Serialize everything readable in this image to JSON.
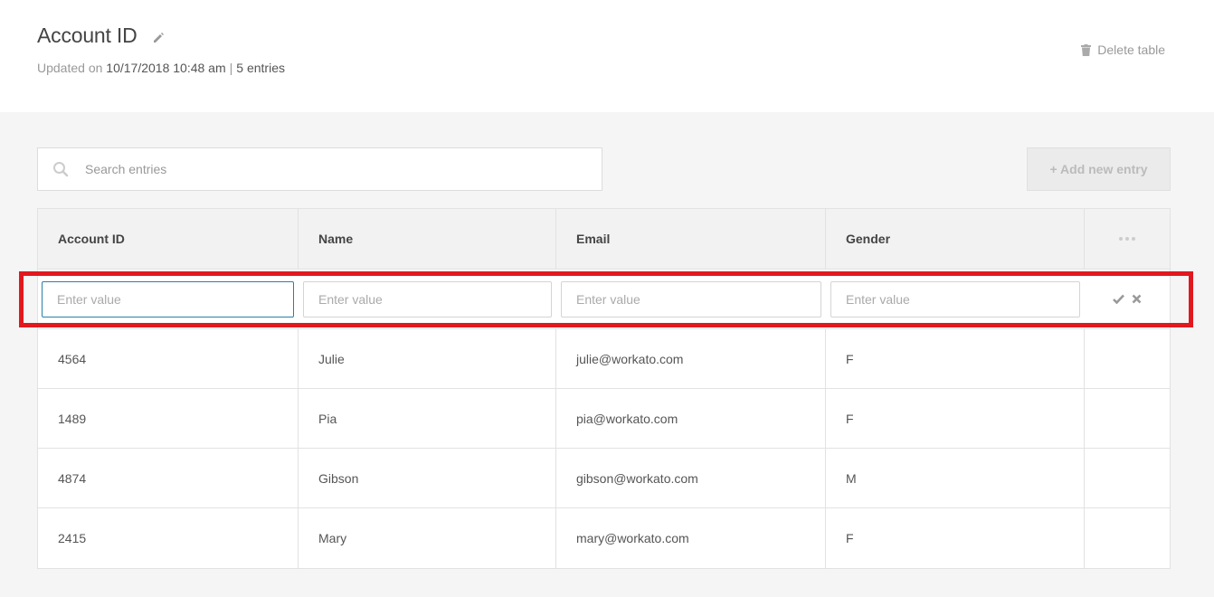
{
  "header": {
    "title": "Account ID",
    "updated_prefix": "Updated on",
    "updated_value": "10/17/2018 10:48 am",
    "separator": "|",
    "entries": "5 entries",
    "delete_label": "Delete table"
  },
  "toolbar": {
    "search_placeholder": "Search entries",
    "add_label": "+ Add new entry"
  },
  "table": {
    "columns": [
      "Account ID",
      "Name",
      "Email",
      "Gender"
    ],
    "menu_glyph": "•••",
    "edit_row": {
      "placeholders": [
        "Enter value",
        "Enter value",
        "Enter value",
        "Enter value"
      ],
      "confirm_icon": "check-icon",
      "cancel_icon": "close-icon"
    },
    "rows": [
      [
        "4564",
        "Julie",
        "julie@workato.com",
        "F"
      ],
      [
        "1489",
        "Pia",
        "pia@workato.com",
        "F"
      ],
      [
        "4874",
        "Gibson",
        "gibson@workato.com",
        "M"
      ],
      [
        "2415",
        "Mary",
        "mary@workato.com",
        "F"
      ]
    ]
  },
  "colors": {
    "highlight": "#e2181f",
    "focus_border": "#2a7fa8",
    "muted_text": "#999999"
  }
}
